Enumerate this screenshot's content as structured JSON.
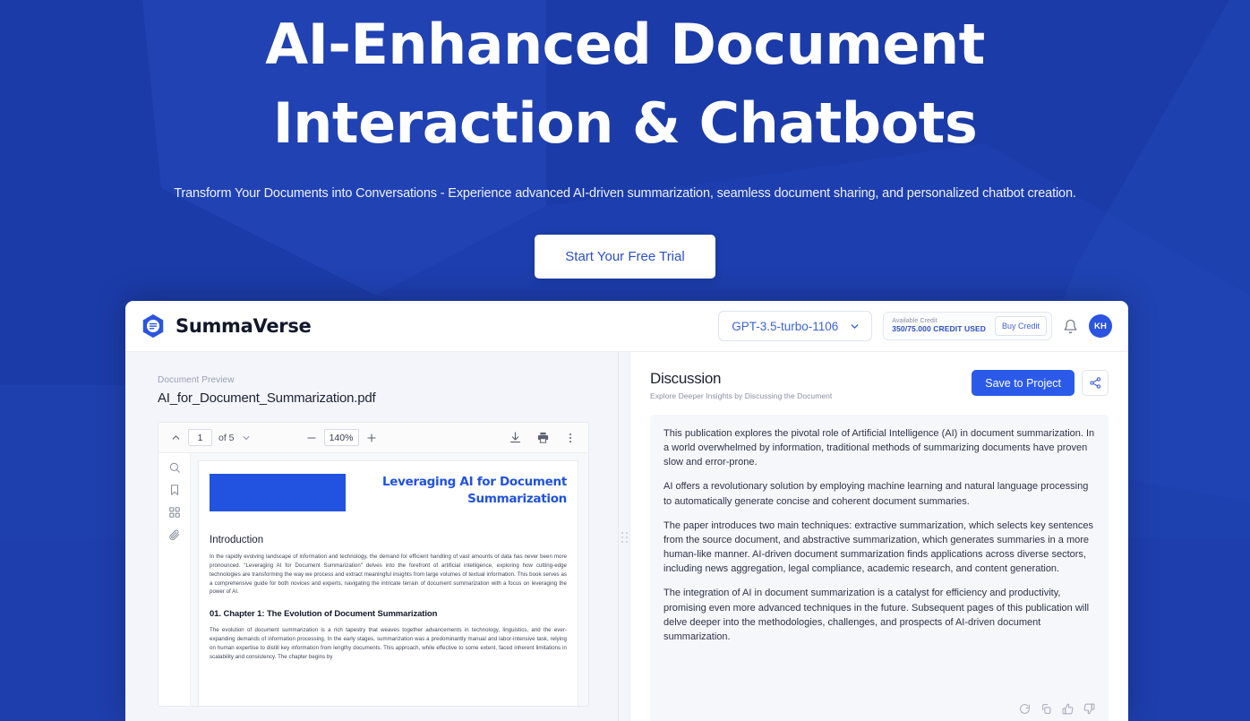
{
  "hero": {
    "title_line1": "AI-Enhanced Document",
    "title_line2": "Interaction & Chatbots",
    "subtitle": "Transform Your Documents into Conversations - Experience advanced AI-driven summarization, seamless document sharing, and personalized chatbot creation.",
    "cta_label": "Start Your Free Trial",
    "bg_color": "#1b3ba8",
    "cta_text_color": "#2b4fc9"
  },
  "app": {
    "brand": {
      "name": "SummaVerse",
      "logo_icon": "hexagon-document-icon"
    },
    "topbar": {
      "model_select": {
        "value": "GPT-3.5-turbo-1106",
        "chevron_icon": "chevron-down-icon"
      },
      "credit": {
        "label": "Available Credit",
        "value": "350/75.000 CREDIT USED",
        "buy_label": "Buy Credit"
      },
      "notification_icon": "bell-icon",
      "avatar_initials": "KH",
      "accent_color": "#2b55e0"
    },
    "left_pane": {
      "preview_label": "Document Preview",
      "filename": "AI_for_Document_Summarization.pdf",
      "pdf_toolbar": {
        "prev_icon": "chevron-up-icon",
        "page_value": "1",
        "page_total": "of 5",
        "page_dropdown_icon": "chevron-down-icon",
        "zoom_out_icon": "minus-icon",
        "zoom_value": "140%",
        "zoom_in_icon": "plus-icon",
        "download_icon": "download-icon",
        "print_icon": "print-icon",
        "more_icon": "more-vertical-icon"
      },
      "pdf_tools": [
        {
          "name": "search-icon"
        },
        {
          "name": "bookmark-icon"
        },
        {
          "name": "thumbnails-grid-icon"
        },
        {
          "name": "attachment-icon"
        }
      ],
      "pdf_page": {
        "title": "Leveraging AI for Document Summarization",
        "heading_intro": "Introduction",
        "intro_paragraph": "In the rapidly evolving landscape of information and technology, the demand for efficient handling of vast amounts of data has never been more pronounced. \"Leveraging AI for Document Summarization\" delves into the forefront of artificial intelligence, exploring how cutting-edge technologies are transforming the way we process and extract meaningful insights from large volumes of textual information. This book serves as a comprehensive guide for both novices and experts, navigating the intricate terrain of document summarization with a focus on leveraging the power of AI.",
        "chapter_heading": "01.  Chapter 1: The Evolution of Document Summarization",
        "chapter_paragraph": "The evolution of document summarization is a rich tapestry that weaves together advancements in technology, linguistics, and the ever-expanding demands of information processing. In the early stages, summarization was a predominantly manual and labor-intensive task, relying on human expertise to distill key information from lengthy documents. This approach, while effective to some extent, faced inherent limitations in scalability and consistency. The chapter begins by",
        "accent_color": "#2152e0"
      }
    },
    "divider": {
      "handle_icon": "drag-handle-icon"
    },
    "right_pane": {
      "title": "Discussion",
      "subtitle": "Explore Deeper Insights by Discussing the Document",
      "save_label": "Save to Project",
      "share_icon": "share-nodes-icon",
      "save_color": "#2b5ae8",
      "paragraphs": [
        "This publication explores the pivotal role of Artificial Intelligence (AI) in document summarization. In a world overwhelmed by information, traditional methods of summarizing documents have proven slow and error-prone.",
        "AI offers a revolutionary solution by employing machine learning and natural language processing to automatically generate concise and coherent document summaries.",
        "The paper introduces two main techniques: extractive summarization, which selects key sentences from the source document, and abstractive summarization, which generates summaries in a more human-like manner. AI-driven document summarization finds applications across diverse sectors, including news aggregation, legal compliance, academic research, and content generation.",
        "The integration of AI in document summarization is a catalyst for efficiency and productivity, promising even more advanced techniques in the future. Subsequent pages of this publication will delve deeper into the methodologies, challenges, and prospects of AI-driven document summarization."
      ],
      "feedback_icons": [
        {
          "name": "regenerate-icon"
        },
        {
          "name": "copy-icon"
        },
        {
          "name": "thumbs-up-icon"
        },
        {
          "name": "thumbs-down-icon"
        }
      ]
    }
  }
}
